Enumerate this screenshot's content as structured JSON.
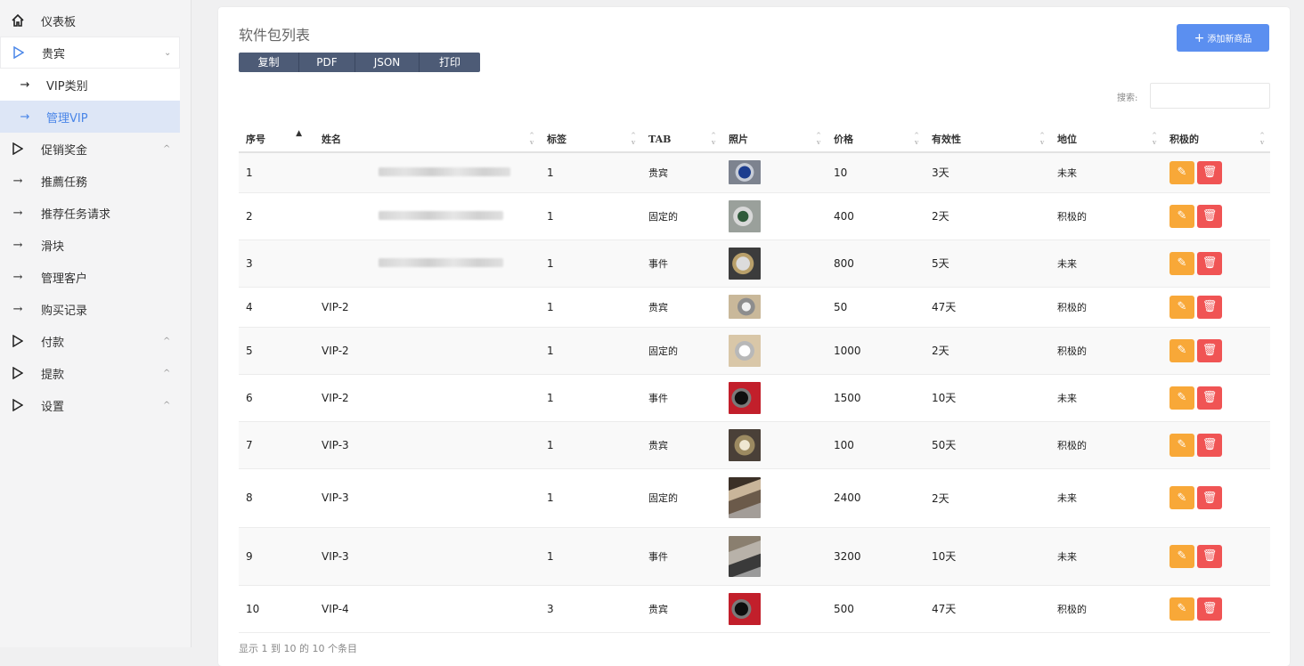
{
  "sidebar": {
    "items": [
      {
        "label": "仪表板",
        "icon": "home-icon"
      },
      {
        "label": "贵宾",
        "icon": "triangle-right-icon",
        "chevron": "⌄"
      },
      {
        "label": "VIP类别",
        "icon": "arrow-right-icon"
      },
      {
        "label": "管理VIP",
        "icon": "arrow-right-icon"
      },
      {
        "label": "促销奖金",
        "icon": "triangle-right-icon",
        "chevron": "^"
      },
      {
        "label": "推薦任務",
        "icon": "arrow-right-icon"
      },
      {
        "label": "推荐任务请求",
        "icon": "arrow-right-icon"
      },
      {
        "label": "滑块",
        "icon": "arrow-right-icon"
      },
      {
        "label": "管理客户",
        "icon": "arrow-right-icon"
      },
      {
        "label": "购买记录",
        "icon": "arrow-right-icon"
      },
      {
        "label": "付款",
        "icon": "triangle-right-icon",
        "chevron": "^"
      },
      {
        "label": "提款",
        "icon": "triangle-right-icon",
        "chevron": "^"
      },
      {
        "label": "设置",
        "icon": "triangle-right-icon",
        "chevron": "^"
      }
    ]
  },
  "card": {
    "title": "软件包列表",
    "export_buttons": [
      "复制",
      "PDF",
      "JSON",
      "打印"
    ],
    "add_button": "添加新商品",
    "search_label": "搜索:",
    "search_value": "",
    "footer": "显示 1 到 10 的 10 个条目"
  },
  "table": {
    "columns": [
      "序号",
      "姓名",
      "标签",
      "TAB",
      "照片",
      "价格",
      "有效性",
      "地位",
      "积极的"
    ],
    "rows": [
      {
        "no": "1",
        "name": "",
        "tag": "1",
        "tab": "贵宾",
        "photo": "watch-blue",
        "price": "10",
        "validity": "3天",
        "status": "未来"
      },
      {
        "no": "2",
        "name": "",
        "tag": "1",
        "tab": "固定的",
        "photo": "watch-green",
        "price": "400",
        "validity": "2天",
        "status": "积极的"
      },
      {
        "no": "3",
        "name": "",
        "tag": "1",
        "tab": "事件",
        "photo": "watch-gold",
        "price": "800",
        "validity": "5天",
        "status": "未来"
      },
      {
        "no": "4",
        "name": "VIP-2",
        "tag": "1",
        "tab": "贵宾",
        "photo": "watch-steel",
        "price": "50",
        "validity": "47天",
        "status": "积极的"
      },
      {
        "no": "5",
        "name": "VIP-2",
        "tag": "1",
        "tab": "固定的",
        "photo": "watch-white",
        "price": "1000",
        "validity": "2天",
        "status": "积极的"
      },
      {
        "no": "6",
        "name": "VIP-2",
        "tag": "1",
        "tab": "事件",
        "photo": "watch-red",
        "price": "1500",
        "validity": "10天",
        "status": "未来"
      },
      {
        "no": "7",
        "name": "VIP-3",
        "tag": "1",
        "tab": "贵宾",
        "photo": "watch-two-tone",
        "price": "100",
        "validity": "50天",
        "status": "积极的"
      },
      {
        "no": "8",
        "name": "VIP-3",
        "tag": "1",
        "tab": "固定的",
        "photo": "watch-bracelet",
        "price": "2400",
        "validity": "2天",
        "status": "未来"
      },
      {
        "no": "9",
        "name": "VIP-3",
        "tag": "1",
        "tab": "事件",
        "photo": "watch-gray",
        "price": "3200",
        "validity": "10天",
        "status": "未来"
      },
      {
        "no": "10",
        "name": "VIP-4",
        "tag": "3",
        "tab": "贵宾",
        "photo": "watch-red",
        "price": "500",
        "validity": "47天",
        "status": "积极的"
      }
    ]
  },
  "colors": {
    "accent": "#5b8ff0",
    "edit": "#f8a838",
    "delete": "#f05454",
    "export": "#4d5b76"
  }
}
